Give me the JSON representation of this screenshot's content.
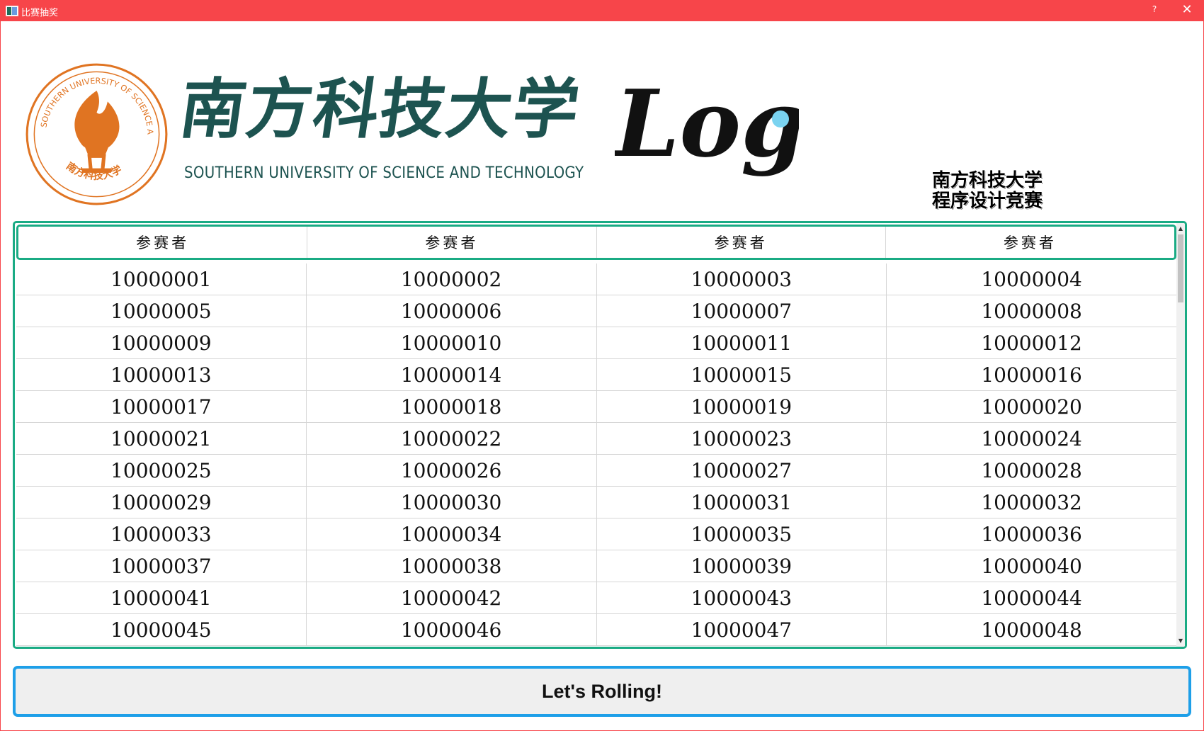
{
  "window": {
    "title": "比赛抽奖",
    "help_label": "?",
    "close_label": "✕"
  },
  "header": {
    "university_cn": "南方科技大学",
    "university_en": "SOUTHERN UNIVERSITY OF SCIENCE AND TECHNOLOGY",
    "seal_text_en": "SOUTHERN UNIVERSITY OF SCIENCE AND TECHNOLOGY",
    "seal_text_cn": "南方科技大学",
    "logo_text": "Logo",
    "contest_line1": "南方科技大学",
    "contest_line2": "程序设计竞赛",
    "colors": {
      "brand_green": "#1d5350",
      "seal_orange": "#e07422",
      "logo_dot": "#7ad3f0"
    }
  },
  "table": {
    "headers": [
      "参赛者",
      "参赛者",
      "参赛者",
      "参赛者"
    ],
    "rows": [
      [
        "10000001",
        "10000002",
        "10000003",
        "10000004"
      ],
      [
        "10000005",
        "10000006",
        "10000007",
        "10000008"
      ],
      [
        "10000009",
        "10000010",
        "10000011",
        "10000012"
      ],
      [
        "10000013",
        "10000014",
        "10000015",
        "10000016"
      ],
      [
        "10000017",
        "10000018",
        "10000019",
        "10000020"
      ],
      [
        "10000021",
        "10000022",
        "10000023",
        "10000024"
      ],
      [
        "10000025",
        "10000026",
        "10000027",
        "10000028"
      ],
      [
        "10000029",
        "10000030",
        "10000031",
        "10000032"
      ],
      [
        "10000033",
        "10000034",
        "10000035",
        "10000036"
      ],
      [
        "10000037",
        "10000038",
        "10000039",
        "10000040"
      ],
      [
        "10000041",
        "10000042",
        "10000043",
        "10000044"
      ],
      [
        "10000045",
        "10000046",
        "10000047",
        "10000048"
      ]
    ],
    "colors": {
      "border": "#1aab84"
    }
  },
  "action": {
    "roll_label": "Let's Rolling!",
    "border_color": "#1e9fe8"
  },
  "colors": {
    "titlebar": "#f7454a"
  }
}
